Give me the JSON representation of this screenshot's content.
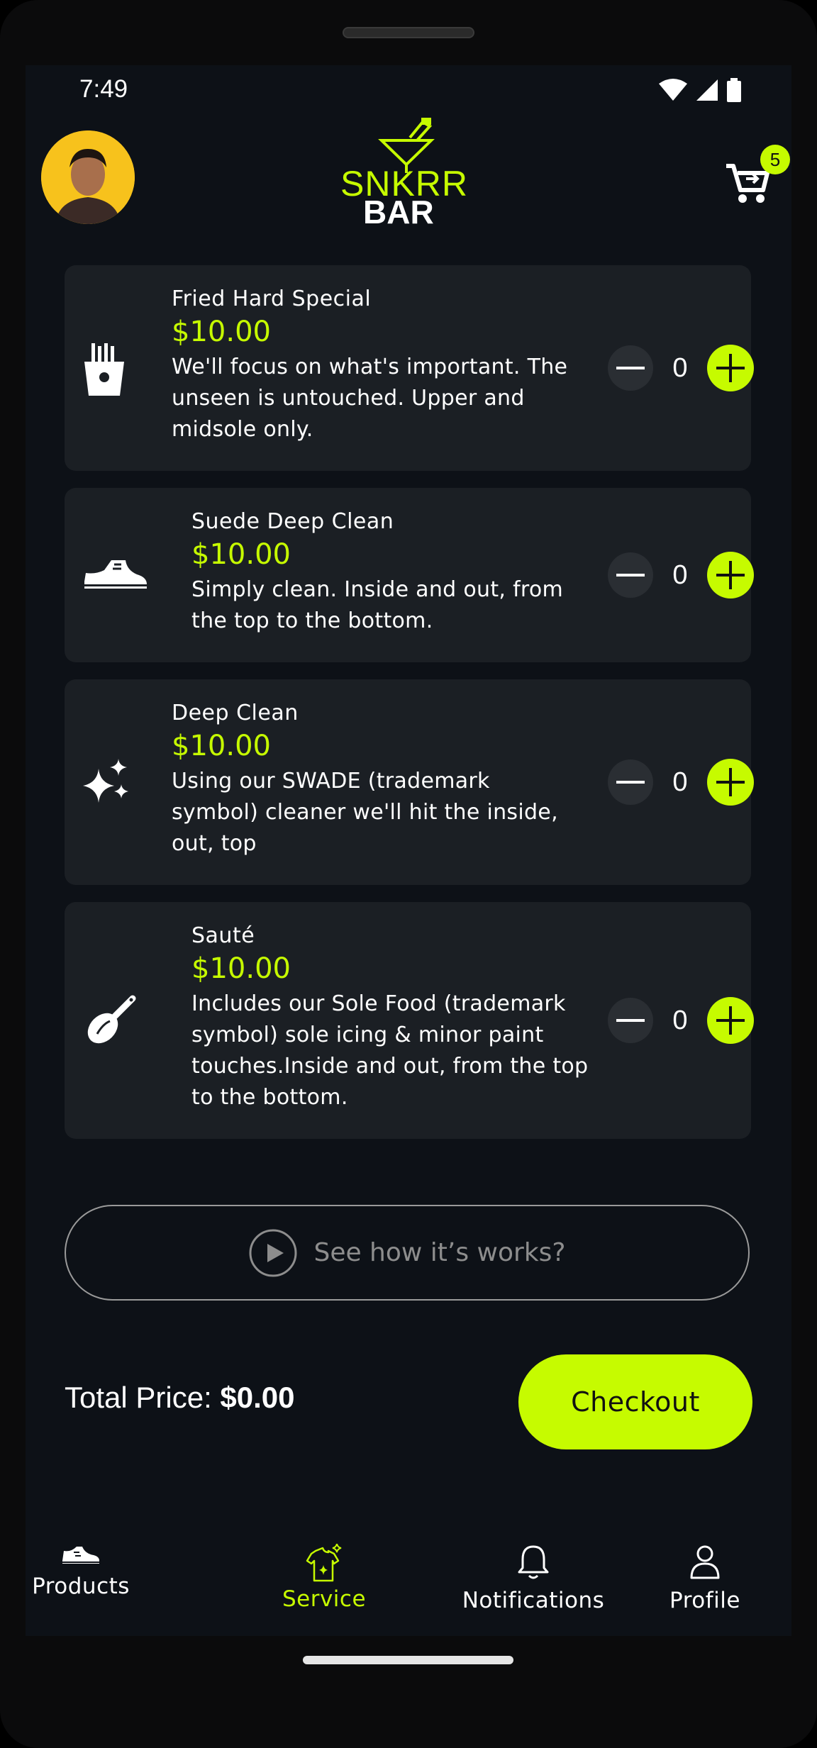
{
  "status_bar": {
    "time": "7:49"
  },
  "header": {
    "logo_top": "SNKRR",
    "logo_bottom": "BAR",
    "cart_count": "5",
    "icons": [
      "avatar",
      "cocktail-logo-icon",
      "cart-icon"
    ]
  },
  "services": [
    {
      "icon": "fries-icon",
      "title": "Fried Hard Special",
      "price": "$10.00",
      "description": "We'll focus on what's important. The unseen is untouched. Upper and midsole only.",
      "quantity": "0"
    },
    {
      "icon": "shoe-icon",
      "title": "Suede Deep Clean",
      "price": "$10.00",
      "description": "Simply clean. Inside and out, from the top to the bottom.",
      "quantity": "0"
    },
    {
      "icon": "sparkles-icon",
      "title": "Deep Clean",
      "price": "$10.00",
      "description": "Using our SWADE (trademark symbol) cleaner we'll hit the inside, out, top",
      "quantity": "0"
    },
    {
      "icon": "spatula-icon",
      "title": "Sauté",
      "price": "$10.00",
      "description": "Includes our Sole Food (trademark symbol) sole icing & minor paint touches.Inside and out, from the top to the bottom.",
      "quantity": "0"
    }
  ],
  "how_it_works": {
    "label": "See how it’s works?"
  },
  "footer": {
    "total_label": "Total Price:",
    "total_value": "$0.00",
    "checkout_label": "Checkout"
  },
  "bottom_nav": {
    "items": [
      {
        "label": "Products",
        "icon": "sneaker-icon"
      },
      {
        "label": "Service",
        "icon": "shirt-sparkle-icon",
        "active": true
      },
      {
        "label": "Notifications",
        "icon": "bell-icon"
      },
      {
        "label": "Profile",
        "icon": "person-icon"
      }
    ]
  },
  "colors": {
    "accent": "#c6fb00",
    "background": "#0d1117",
    "card": "#1b1f24"
  }
}
